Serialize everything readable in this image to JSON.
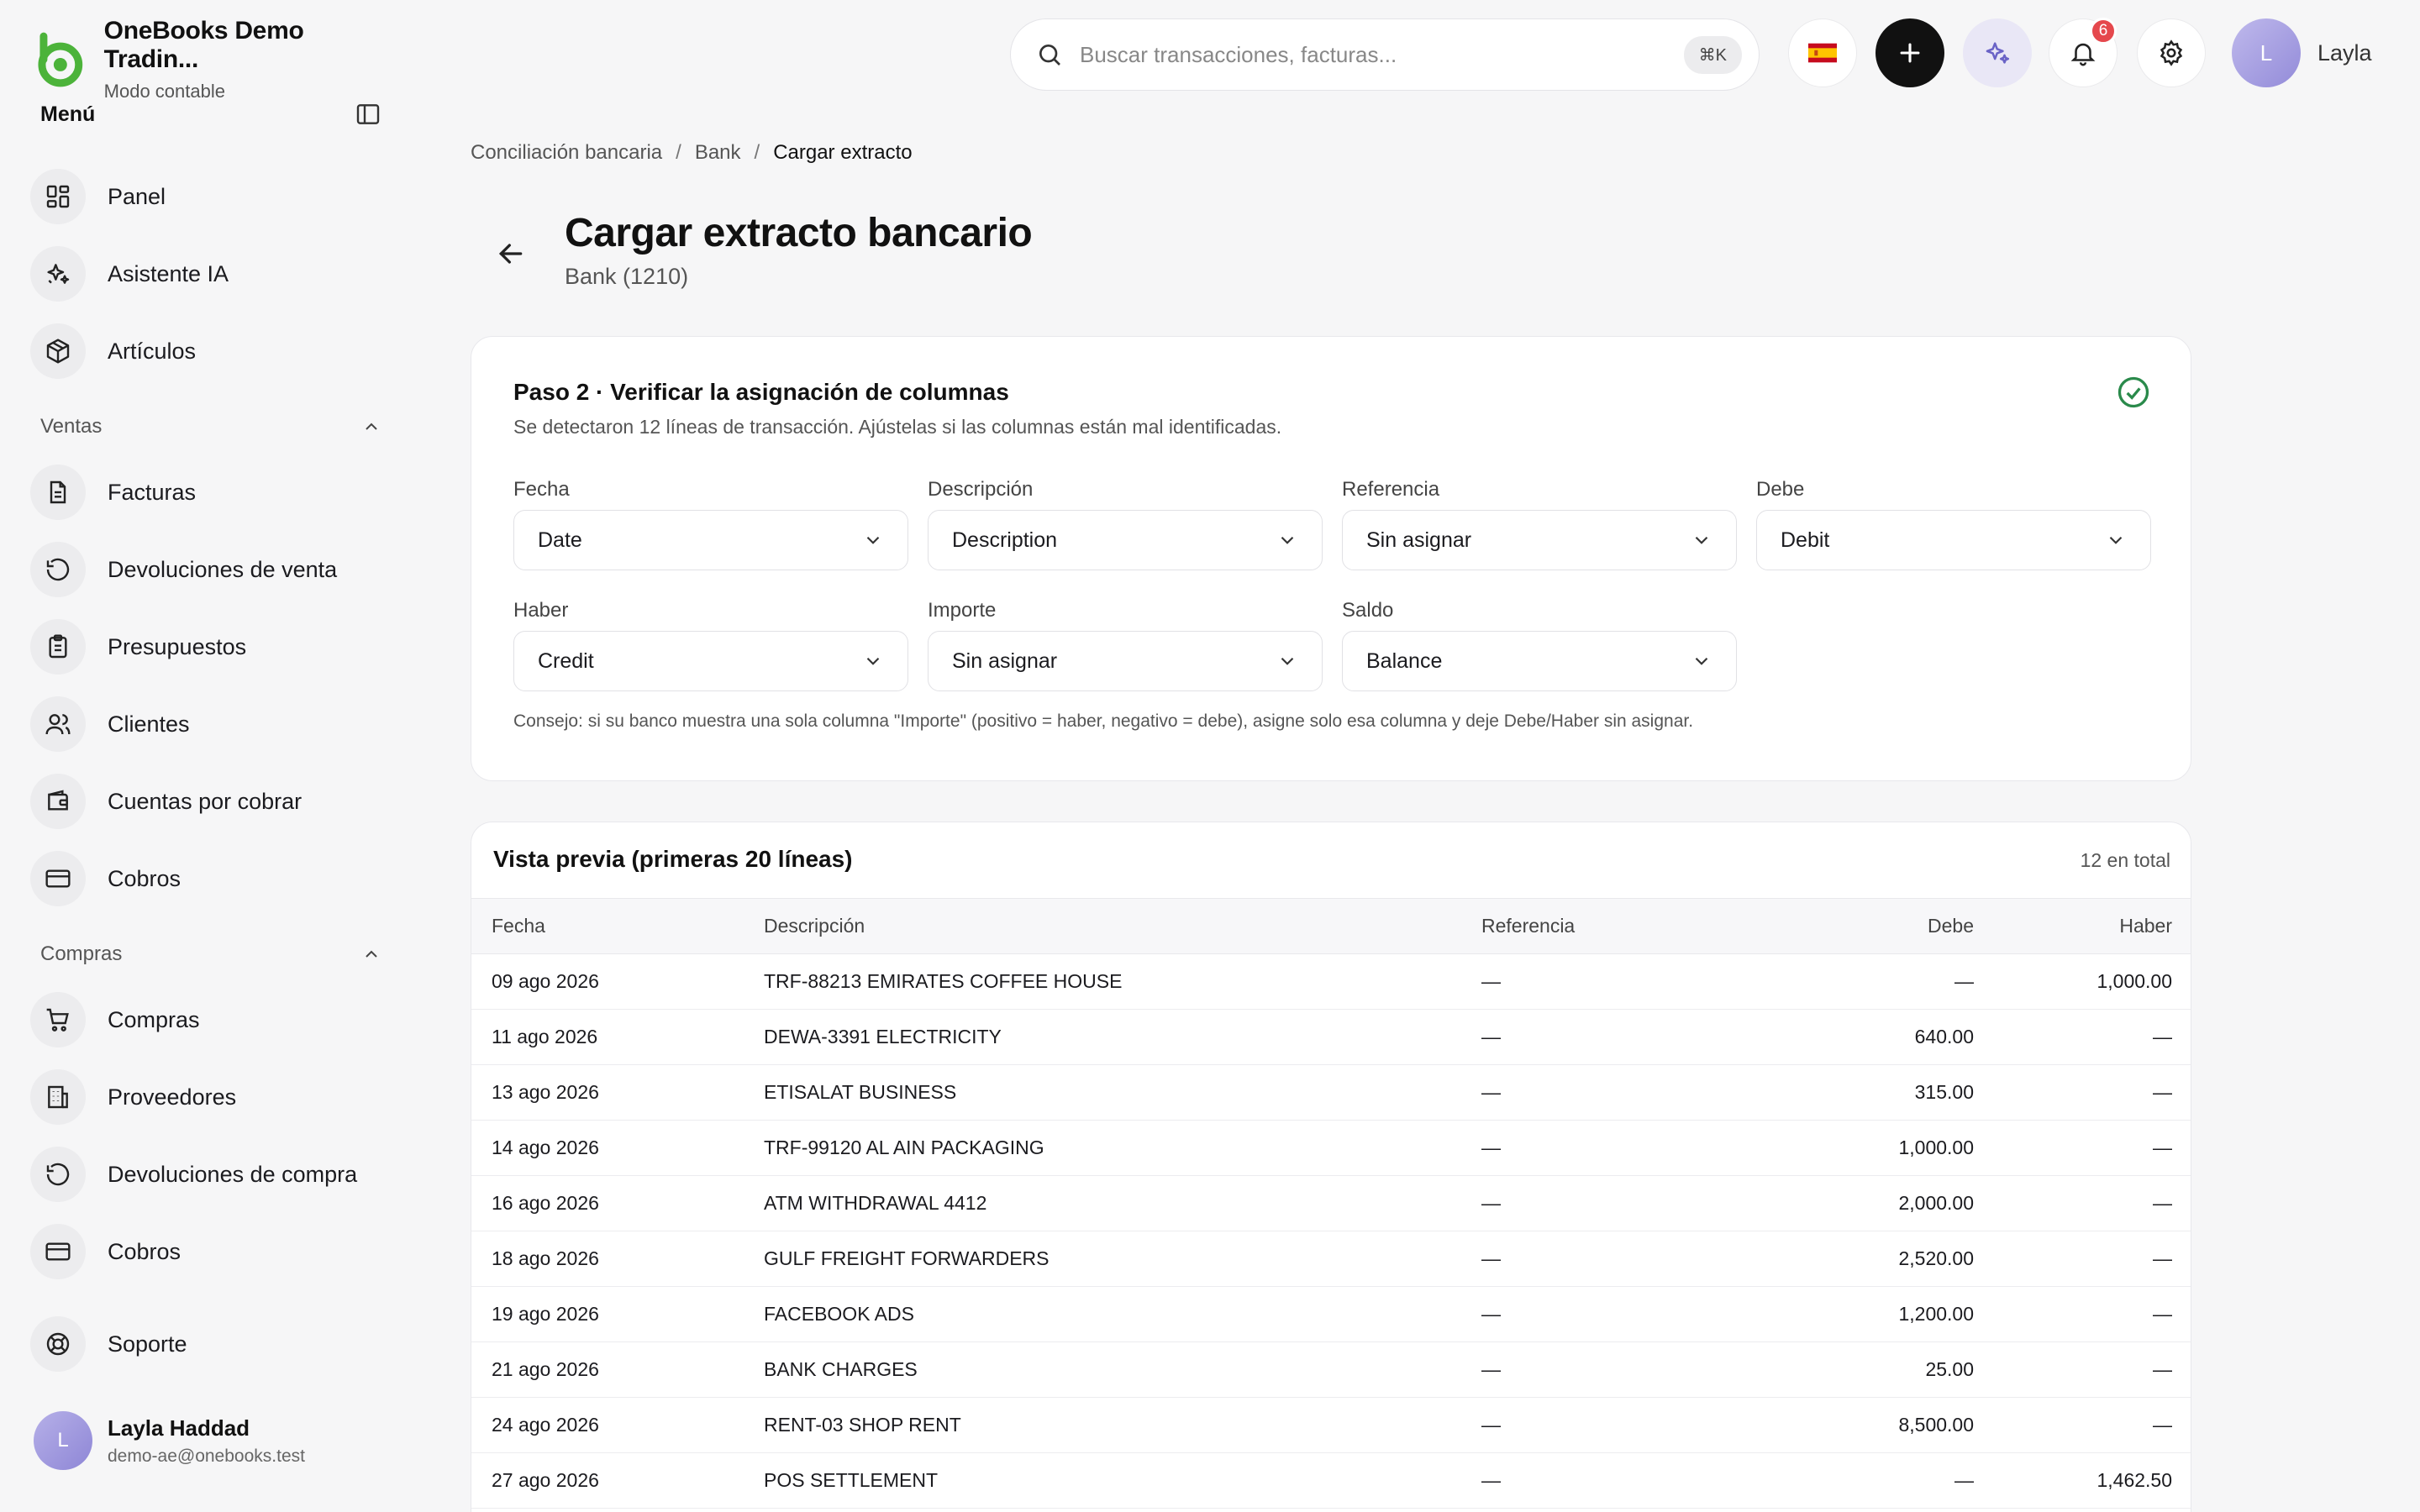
{
  "brand": {
    "name": "OneBooks Demo Tradin...",
    "subtitle": "Modo contable",
    "accent": "#4cb33a"
  },
  "sidebar": {
    "menu_title": "Menú",
    "items_top": [
      {
        "label": "Panel",
        "icon": "grid-icon"
      },
      {
        "label": "Asistente IA",
        "icon": "sparkles-icon"
      },
      {
        "label": "Artículos",
        "icon": "box-icon"
      }
    ],
    "sections": [
      {
        "title": "Ventas",
        "items": [
          {
            "label": "Facturas",
            "icon": "file-text-icon"
          },
          {
            "label": "Devoluciones de venta",
            "icon": "rotate-ccw-icon"
          },
          {
            "label": "Presupuestos",
            "icon": "clipboard-icon"
          },
          {
            "label": "Clientes",
            "icon": "users-icon"
          },
          {
            "label": "Cuentas por cobrar",
            "icon": "wallet-icon"
          },
          {
            "label": "Cobros",
            "icon": "credit-card-icon"
          }
        ]
      },
      {
        "title": "Compras",
        "items": [
          {
            "label": "Compras",
            "icon": "cart-icon"
          },
          {
            "label": "Proveedores",
            "icon": "building-icon"
          },
          {
            "label": "Devoluciones de compra",
            "icon": "rotate-ccw-icon"
          },
          {
            "label": "Cobros",
            "icon": "credit-card-icon"
          }
        ]
      }
    ],
    "support": {
      "label": "Soporte",
      "icon": "lifebuoy-icon"
    },
    "user": {
      "initial": "L",
      "name": "Layla Haddad",
      "email": "demo-ae@onebooks.test"
    }
  },
  "topbar": {
    "search_placeholder": "Buscar transacciones, facturas...",
    "shortcut": "⌘K",
    "notifications_count": "6",
    "user_initial": "L",
    "user_name": "Layla"
  },
  "breadcrumb": [
    "Conciliación bancaria",
    "Bank",
    "Cargar extracto"
  ],
  "page": {
    "title": "Cargar extracto bancario",
    "subtitle": "Bank (1210)"
  },
  "step": {
    "title": "Paso 2 · Verificar la asignación de columnas",
    "description": "Se detectaron 12 líneas de transacción. Ajústelas si las columnas están mal identificadas.",
    "fields": [
      {
        "label": "Fecha",
        "value": "Date"
      },
      {
        "label": "Descripción",
        "value": "Description"
      },
      {
        "label": "Referencia",
        "value": "Sin asignar"
      },
      {
        "label": "Debe",
        "value": "Debit"
      },
      {
        "label": "Haber",
        "value": "Credit"
      },
      {
        "label": "Importe",
        "value": "Sin asignar"
      },
      {
        "label": "Saldo",
        "value": "Balance"
      }
    ],
    "tip": "Consejo: si su banco muestra una sola columna \"Importe\" (positivo = haber, negativo = debe), asigne solo esa columna y deje Debe/Haber sin asignar."
  },
  "preview": {
    "title": "Vista previa (primeras 20 líneas)",
    "count": "12 en total",
    "columns": [
      "Fecha",
      "Descripción",
      "Referencia",
      "Debe",
      "Haber"
    ],
    "rows": [
      [
        "09 ago 2026",
        "TRF-88213 EMIRATES COFFEE HOUSE",
        "—",
        "—",
        "1,000.00"
      ],
      [
        "11 ago 2026",
        "DEWA-3391 ELECTRICITY",
        "—",
        "640.00",
        "—"
      ],
      [
        "13 ago 2026",
        "ETISALAT BUSINESS",
        "—",
        "315.00",
        "—"
      ],
      [
        "14 ago 2026",
        "TRF-99120 AL AIN PACKAGING",
        "—",
        "1,000.00",
        "—"
      ],
      [
        "16 ago 2026",
        "ATM WITHDRAWAL 4412",
        "—",
        "2,000.00",
        "—"
      ],
      [
        "18 ago 2026",
        "GULF FREIGHT FORWARDERS",
        "—",
        "2,520.00",
        "—"
      ],
      [
        "19 ago 2026",
        "FACEBOOK ADS",
        "—",
        "1,200.00",
        "—"
      ],
      [
        "21 ago 2026",
        "BANK CHARGES",
        "—",
        "25.00",
        "—"
      ],
      [
        "24 ago 2026",
        "RENT-03 SHOP RENT",
        "—",
        "8,500.00",
        "—"
      ],
      [
        "27 ago 2026",
        "POS SETTLEMENT",
        "—",
        "—",
        "1,462.50"
      ]
    ]
  }
}
